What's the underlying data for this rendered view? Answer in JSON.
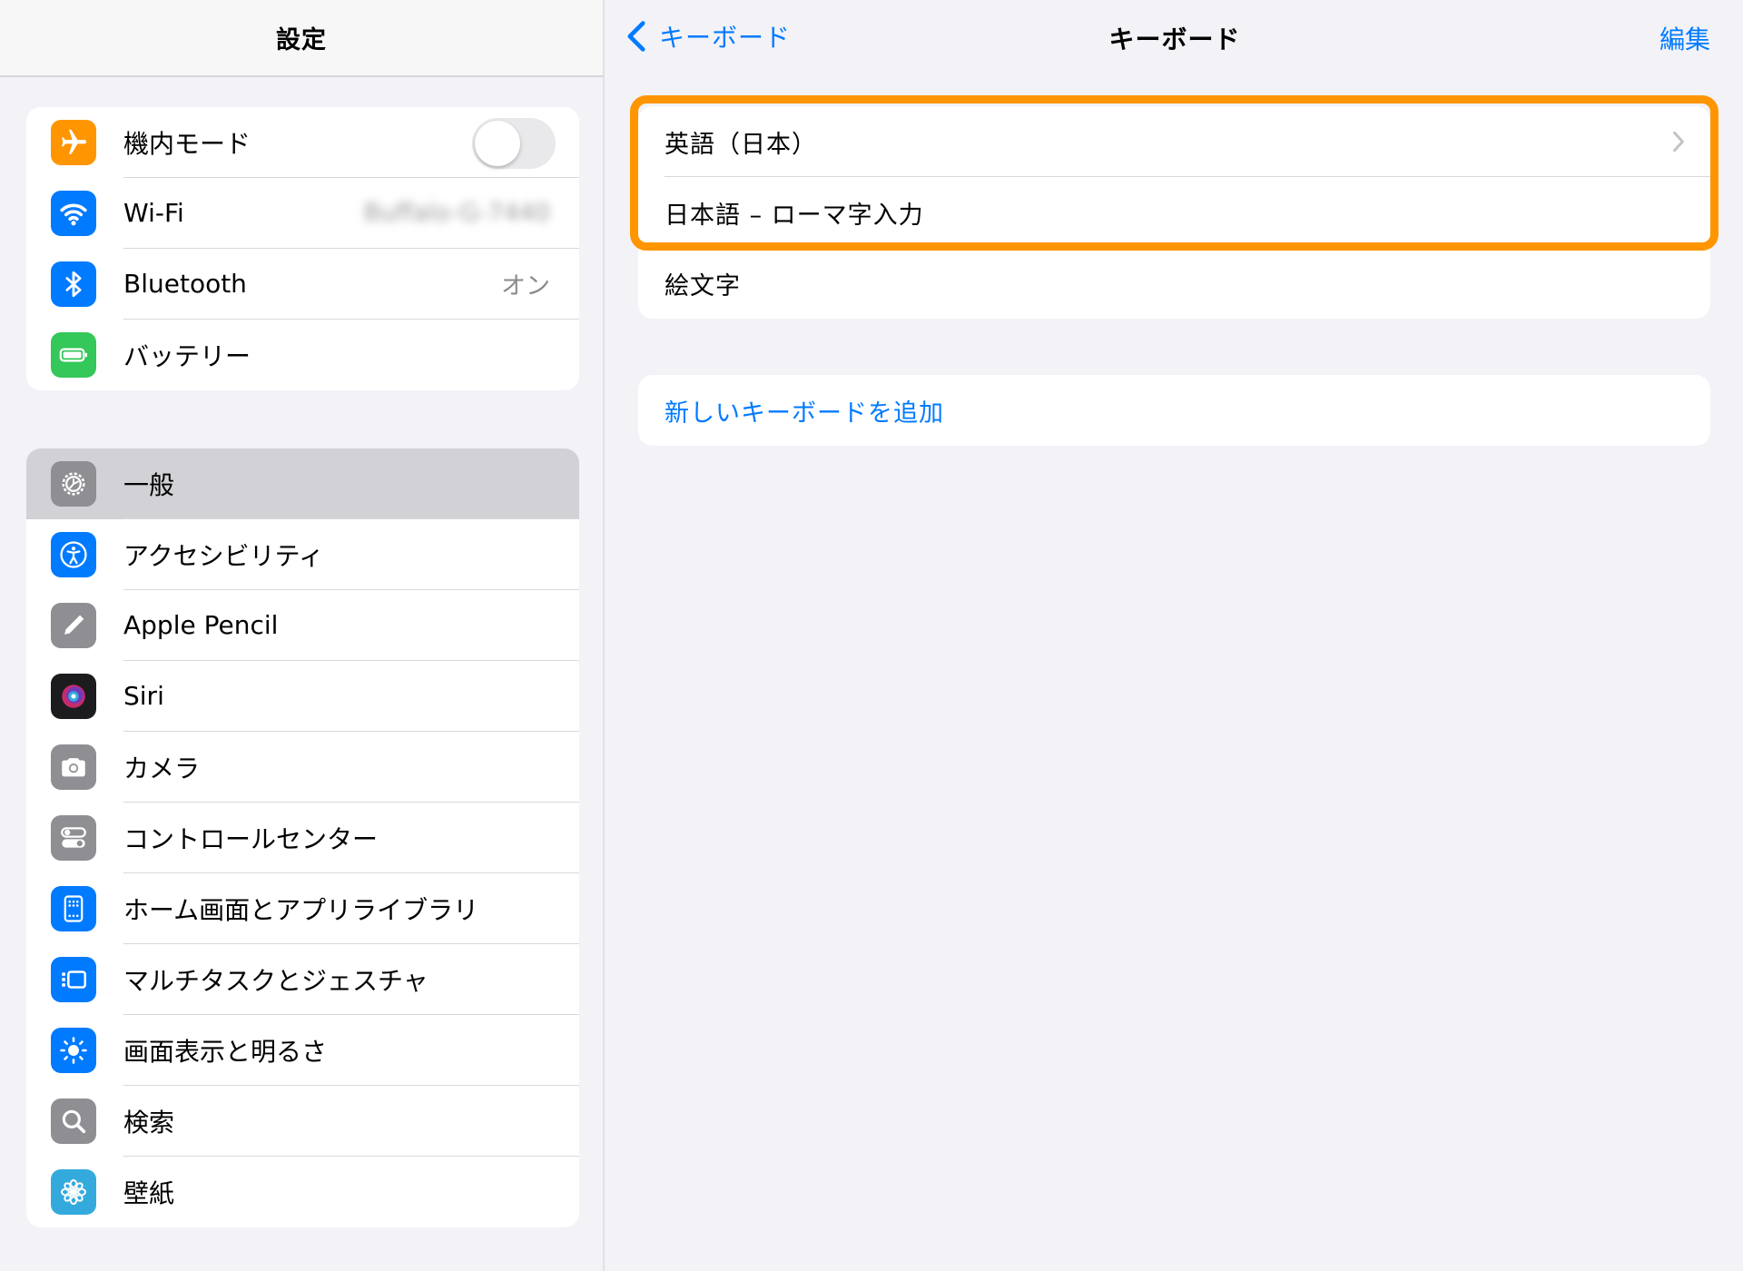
{
  "sidebar": {
    "title": "設定",
    "group1": [
      {
        "label": "機内モード",
        "icon": "airplane-icon",
        "color": "#ff9500",
        "toggle": false
      },
      {
        "label": "Wi-Fi",
        "icon": "wifi-icon",
        "color": "#007aff",
        "value": "Buffalo-G-7440"
      },
      {
        "label": "Bluetooth",
        "icon": "bluetooth-icon",
        "color": "#007aff",
        "value": "オン"
      },
      {
        "label": "バッテリー",
        "icon": "battery-icon",
        "color": "#34c759"
      }
    ],
    "group2": [
      {
        "label": "一般",
        "icon": "gear-icon",
        "color": "#8e8e93",
        "selected": true
      },
      {
        "label": "アクセシビリティ",
        "icon": "accessibility-icon",
        "color": "#007aff"
      },
      {
        "label": "Apple Pencil",
        "icon": "pencil-icon",
        "color": "#8e8e93"
      },
      {
        "label": "Siri",
        "icon": "siri-icon",
        "color": "#1c1c1e"
      },
      {
        "label": "カメラ",
        "icon": "camera-icon",
        "color": "#8e8e93"
      },
      {
        "label": "コントロールセンター",
        "icon": "control-center-icon",
        "color": "#8e8e93"
      },
      {
        "label": "ホーム画面とアプリライブラリ",
        "icon": "home-screen-icon",
        "color": "#007aff"
      },
      {
        "label": "マルチタスクとジェスチャ",
        "icon": "multitask-icon",
        "color": "#007aff"
      },
      {
        "label": "画面表示と明るさ",
        "icon": "brightness-icon",
        "color": "#007aff"
      },
      {
        "label": "検索",
        "icon": "search-icon",
        "color": "#8e8e93"
      },
      {
        "label": "壁紙",
        "icon": "wallpaper-icon",
        "color": "#34aadc"
      }
    ]
  },
  "detail": {
    "back_label": "キーボード",
    "title": "キーボード",
    "edit_label": "編集",
    "keyboards": [
      {
        "label": "英語（日本）",
        "chevron": true
      },
      {
        "label": "日本語 – ローマ字入力"
      },
      {
        "label": "絵文字"
      }
    ],
    "add_keyboard_label": "新しいキーボードを追加",
    "highlight_color": "#ff9500"
  }
}
